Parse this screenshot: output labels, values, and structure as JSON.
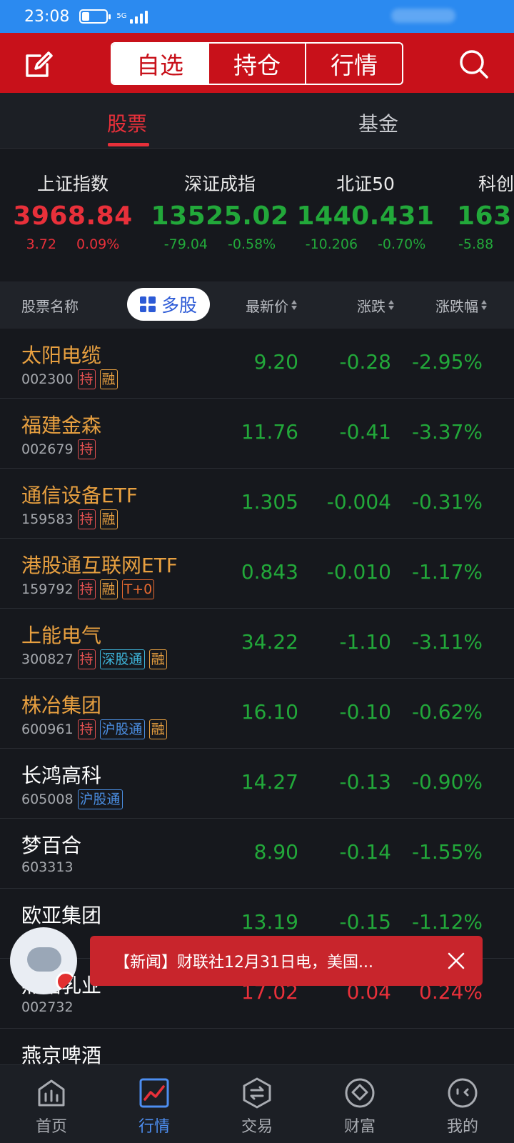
{
  "status": {
    "time": "23:08",
    "network": "5G"
  },
  "topbar": {
    "tabs": [
      "自选",
      "持仓",
      "行情"
    ],
    "active_tab": "自选"
  },
  "subtabs": {
    "stocks": "股票",
    "funds": "基金"
  },
  "indices": [
    {
      "name": "上证指数",
      "value": "3968.84",
      "change": "3.72",
      "pct": "0.09%",
      "dir": "up"
    },
    {
      "name": "深证成指",
      "value": "13525.02",
      "change": "-79.04",
      "pct": "-0.58%",
      "dir": "down"
    },
    {
      "name": "北证50",
      "value": "1440.431",
      "change": "-10.206",
      "pct": "-0.70%",
      "dir": "down"
    },
    {
      "name": "科创",
      "value": "163",
      "change": "-5.88",
      "pct": "",
      "dir": "down"
    }
  ],
  "header": {
    "name": "股票名称",
    "multi": "多股",
    "price": "最新价",
    "change": "涨跌",
    "pct": "涨跌幅"
  },
  "stocks": [
    {
      "name": "太阳电缆",
      "code": "002300",
      "tags": [
        "持",
        "融"
      ],
      "price": "9.20",
      "change": "-0.28",
      "pct": "-2.95%",
      "dir": "down",
      "name_color": "#e8a040"
    },
    {
      "name": "福建金森",
      "code": "002679",
      "tags": [
        "持"
      ],
      "price": "11.76",
      "change": "-0.41",
      "pct": "-3.37%",
      "dir": "down",
      "name_color": "#e8a040"
    },
    {
      "name": "通信设备ETF",
      "code": "159583",
      "tags": [
        "持",
        "融"
      ],
      "price": "1.305",
      "change": "-0.004",
      "pct": "-0.31%",
      "dir": "down",
      "name_color": "#e8a040"
    },
    {
      "name": "港股通互联网ETF",
      "code": "159792",
      "tags": [
        "持",
        "融",
        "T+0"
      ],
      "price": "0.843",
      "change": "-0.010",
      "pct": "-1.17%",
      "dir": "down",
      "name_color": "#e8a040"
    },
    {
      "name": "上能电气",
      "code": "300827",
      "tags": [
        "持",
        "深股通",
        "融"
      ],
      "price": "34.22",
      "change": "-1.10",
      "pct": "-3.11%",
      "dir": "down",
      "name_color": "#e8a040"
    },
    {
      "name": "株冶集团",
      "code": "600961",
      "tags": [
        "持",
        "沪股通",
        "融"
      ],
      "price": "16.10",
      "change": "-0.10",
      "pct": "-0.62%",
      "dir": "down",
      "name_color": "#e8a040"
    },
    {
      "name": "长鸿高科",
      "code": "605008",
      "tags": [
        "沪股通"
      ],
      "price": "14.27",
      "change": "-0.13",
      "pct": "-0.90%",
      "dir": "down",
      "name_color": "#ffffff"
    },
    {
      "name": "梦百合",
      "code": "603313",
      "tags": [],
      "price": "8.90",
      "change": "-0.14",
      "pct": "-1.55%",
      "dir": "down",
      "name_color": "#ffffff"
    },
    {
      "name": "欧亚集团",
      "code": "",
      "tags": [],
      "price": "13.19",
      "change": "-0.15",
      "pct": "-1.12%",
      "dir": "down",
      "name_color": "#ffffff"
    },
    {
      "name": "燕塘乳业",
      "code": "002732",
      "tags": [],
      "price": "17.02",
      "change": "0.04",
      "pct": "0.24%",
      "dir": "up",
      "name_color": "#ffffff"
    },
    {
      "name": "燕京啤酒",
      "code": "",
      "tags": [],
      "price": "",
      "change": "",
      "pct": "",
      "dir": "down",
      "name_color": "#ffffff"
    }
  ],
  "toast": {
    "text": "【新闻】财联社12月31日电，美国..."
  },
  "tabbar": [
    {
      "label": "首页",
      "icon": "home-icon"
    },
    {
      "label": "行情",
      "icon": "chart-icon",
      "active": true
    },
    {
      "label": "交易",
      "icon": "trade-icon"
    },
    {
      "label": "财富",
      "icon": "wealth-icon"
    },
    {
      "label": "我的",
      "icon": "profile-icon"
    }
  ],
  "colors": {
    "up": "#e8303a",
    "down": "#22a83a",
    "brand": "#c8111a",
    "accent": "#4d8ef0"
  }
}
